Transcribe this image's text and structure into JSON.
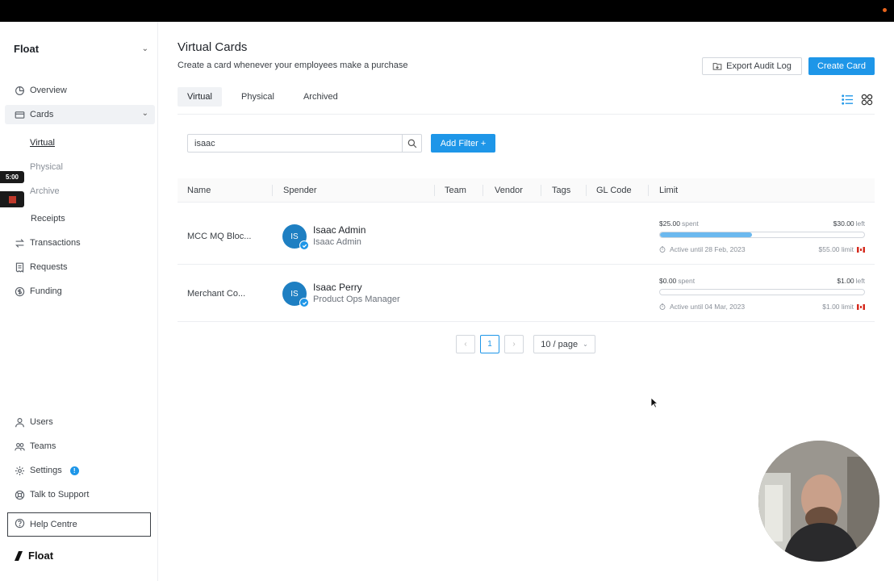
{
  "org": {
    "name": "Float"
  },
  "nav": {
    "overview": "Overview",
    "cards": "Cards",
    "cards_sub": [
      "Virtual",
      "Physical",
      "Archive"
    ],
    "receipts": "Receipts",
    "transactions": "Transactions",
    "requests": "Requests",
    "funding": "Funding",
    "users": "Users",
    "teams": "Teams",
    "settings": "Settings",
    "support": "Talk to Support",
    "help": "Help Centre",
    "settings_badge": "!"
  },
  "recording": {
    "timer": "5:00"
  },
  "logo": {
    "text": "Float"
  },
  "page": {
    "title": "Virtual Cards",
    "subtitle": "Create a card whenever your employees make a purchase",
    "export_label": "Export Audit Log",
    "create_label": "Create Card"
  },
  "tabs": [
    "Virtual",
    "Physical",
    "Archived"
  ],
  "search": {
    "value": "isaac",
    "filter_label": "Add Filter +"
  },
  "table": {
    "headers": [
      "Name",
      "Spender",
      "Team",
      "Vendor",
      "Tags",
      "GL Code",
      "Limit"
    ],
    "rows": [
      {
        "name": "MCC MQ Bloc...",
        "avatar": "IS",
        "spender": "Isaac Admin",
        "role": "Isaac Admin",
        "spent": "$25.00",
        "spent_label": "spent",
        "left": "$30.00",
        "left_label": "left",
        "progress": 0.45,
        "active": "Active until 28 Feb, 2023",
        "limit": "$55.00 limit"
      },
      {
        "name": "Merchant Co...",
        "avatar": "IS",
        "spender": "Isaac Perry",
        "role": "Product Ops Manager",
        "spent": "$0.00",
        "spent_label": "spent",
        "left": "$1.00",
        "left_label": "left",
        "progress": 0,
        "active": "Active until 04 Mar, 2023",
        "limit": "$1.00 limit"
      }
    ]
  },
  "pagination": {
    "prev": "‹",
    "page": "1",
    "next": "›",
    "page_size": "10 / page"
  },
  "colors": {
    "accent": "#1e96e8",
    "progress": "#6cb9ef",
    "topbar": "#000000"
  }
}
